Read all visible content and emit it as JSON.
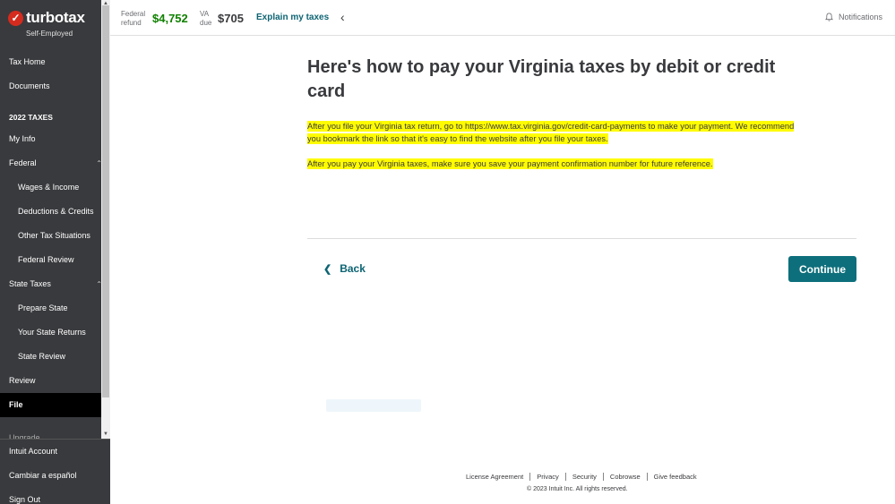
{
  "sidebar": {
    "logo_text": "turbotax",
    "logo_subtitle": "Self-Employed",
    "items": [
      {
        "label": "Tax Home"
      },
      {
        "label": "Documents"
      },
      {
        "label": "2022 TAXES"
      },
      {
        "label": "My Info"
      },
      {
        "label": "Federal"
      },
      {
        "label": "Wages & Income"
      },
      {
        "label": "Deductions & Credits"
      },
      {
        "label": "Other Tax Situations"
      },
      {
        "label": "Federal Review"
      },
      {
        "label": "State Taxes"
      },
      {
        "label": "Prepare State"
      },
      {
        "label": "Your State Returns"
      },
      {
        "label": "State Review"
      },
      {
        "label": "Review"
      },
      {
        "label": "File"
      }
    ],
    "upgrade_label": "Upgrade",
    "bottom_items": [
      {
        "label": "Intuit Account"
      },
      {
        "label": "Cambiar a español"
      },
      {
        "label": "Sign Out"
      }
    ]
  },
  "header": {
    "federal_label": "Federal",
    "refund_label": "refund",
    "federal_amount": "$4,752",
    "va_label": "VA",
    "due_label": "due",
    "va_amount": "$705",
    "explain_link": "Explain my taxes",
    "notifications_label": "Notifications"
  },
  "main": {
    "title": "Here's how to pay your Virginia taxes by debit or credit card",
    "para1": "After you file your Virginia tax return, go to https://www.tax.virginia.gov/credit-card-payments to make your payment. We recommend you bookmark the link so that it's easy to find the website after you file your taxes.",
    "para2": "After you pay your Virginia taxes, make sure you save your payment confirmation number for future reference.",
    "back_label": "Back",
    "continue_label": "Continue"
  },
  "footer": {
    "links": [
      "License Agreement",
      "Privacy",
      "Security",
      "Cobrowse",
      "Give feedback"
    ],
    "copyright": "© 2023 Intuit Inc. All rights reserved."
  },
  "colors": {
    "sidebar_bg": "#393a3d",
    "accent_teal": "#0d6f7b",
    "refund_green": "#108000",
    "highlight": "#fffb00"
  }
}
